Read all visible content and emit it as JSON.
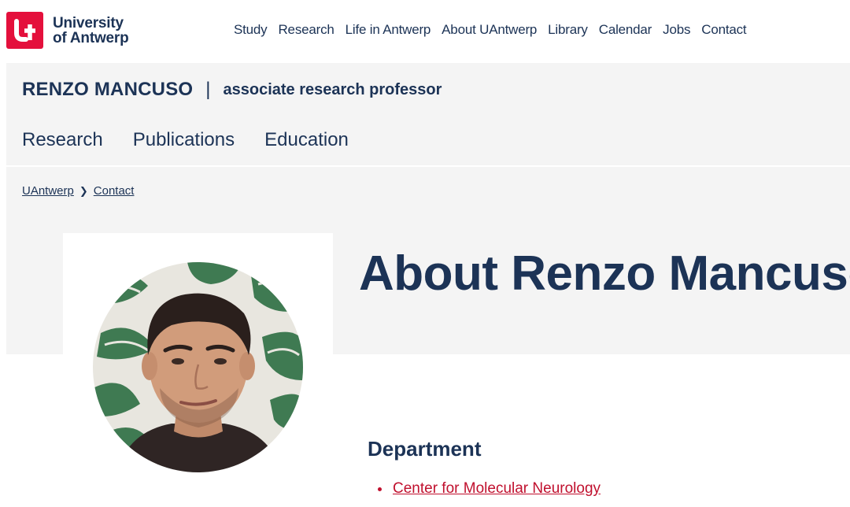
{
  "brand": {
    "logo_line1": "University",
    "logo_line2": "of Antwerp",
    "logo_icon": "uantwerp-u-icon",
    "accent_color": "#e4103c",
    "text_color": "#1c3356"
  },
  "mainnav": [
    "Study",
    "Research",
    "Life in Antwerp",
    "About UAntwerp",
    "Library",
    "Calendar",
    "Jobs",
    "Contact"
  ],
  "profile": {
    "name": "RENZO MANCUSO",
    "separator": "|",
    "role": "associate research professor"
  },
  "subnav": [
    "Research",
    "Publications",
    "Education"
  ],
  "breadcrumb": {
    "items": [
      "UAntwerp",
      "Contact"
    ],
    "separator_icon": "chevron-right-icon"
  },
  "page": {
    "title": "About Renzo Mancuso"
  },
  "department": {
    "heading": "Department",
    "items": [
      "Center for Molecular Neurology"
    ],
    "link_color": "#c0102e"
  }
}
